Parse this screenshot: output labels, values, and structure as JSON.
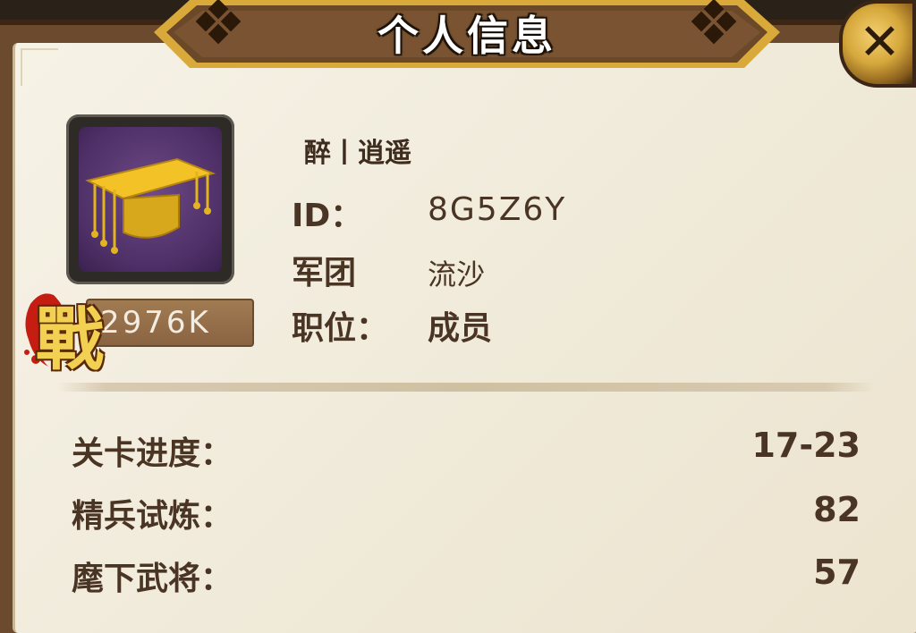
{
  "title": "个人信息",
  "player": {
    "name": "醉丨逍遥",
    "power": "2976K",
    "power_badge": "戰"
  },
  "info": [
    {
      "label": "ID：",
      "value": "8G5Z6Y"
    },
    {
      "label": "军团",
      "value": "流沙"
    },
    {
      "label": "职位：",
      "value": "成员"
    }
  ],
  "stats": [
    {
      "label": "关卡进度：",
      "value": "17-23"
    },
    {
      "label": "精兵试炼：",
      "value": "82"
    },
    {
      "label": "麾下武将：",
      "value": "57"
    }
  ],
  "icons": {
    "avatar": "golden-hat-icon",
    "close": "close-icon",
    "badge": "zhan-battle-badge-icon"
  },
  "colors": {
    "frame": "#6b4a2e",
    "panel": "#f4efe2",
    "text": "#4a3424",
    "avatar_bg": "#4e2f66",
    "gold": "#e8b82a"
  }
}
